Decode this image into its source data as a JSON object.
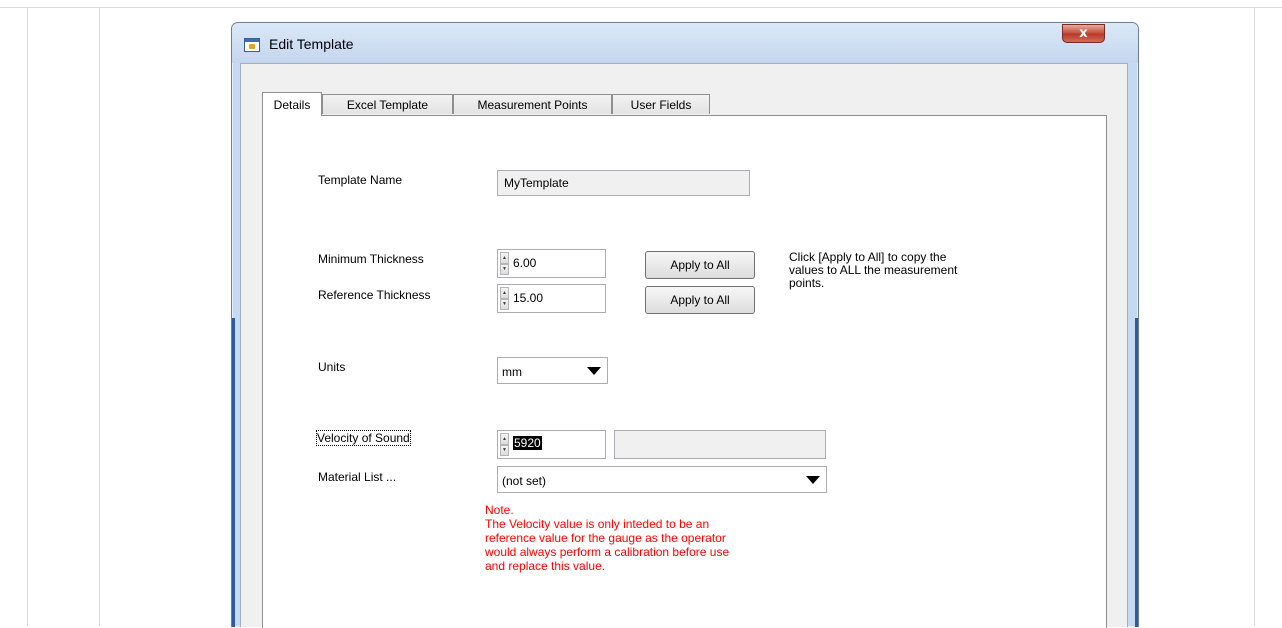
{
  "window": {
    "title": "Edit Template",
    "close_glyph": "x"
  },
  "tabs": [
    {
      "label": "Details",
      "active": true
    },
    {
      "label": "Excel Template",
      "active": false
    },
    {
      "label": "Measurement Points",
      "active": false
    },
    {
      "label": "User Fields",
      "active": false
    }
  ],
  "details": {
    "template_name_label": "Template Name",
    "template_name_value": "MyTemplate",
    "min_thickness_label": "Minimum Thickness",
    "min_thickness_value": "6.00",
    "ref_thickness_label": "Reference Thickness",
    "ref_thickness_value": "15.00",
    "apply_to_all_label": "Apply to All",
    "apply_help_text": "Click [Apply to All] to copy the\nvalues to ALL the measurement\npoints.",
    "units_label": "Units",
    "units_value": "mm",
    "velocity_label": "Velocity of Sound",
    "velocity_value": "5920",
    "material_label": "Material List ...",
    "material_value": "(not set)",
    "note_text": "Note.\nThe Velocity value is only inteded to be an\nreference value for the gauge as the operator\nwould always perform a calibration before use\nand replace this value."
  },
  "colors": {
    "note_red": "#ff0000",
    "titlebar_blue": "#c4d6ee"
  }
}
